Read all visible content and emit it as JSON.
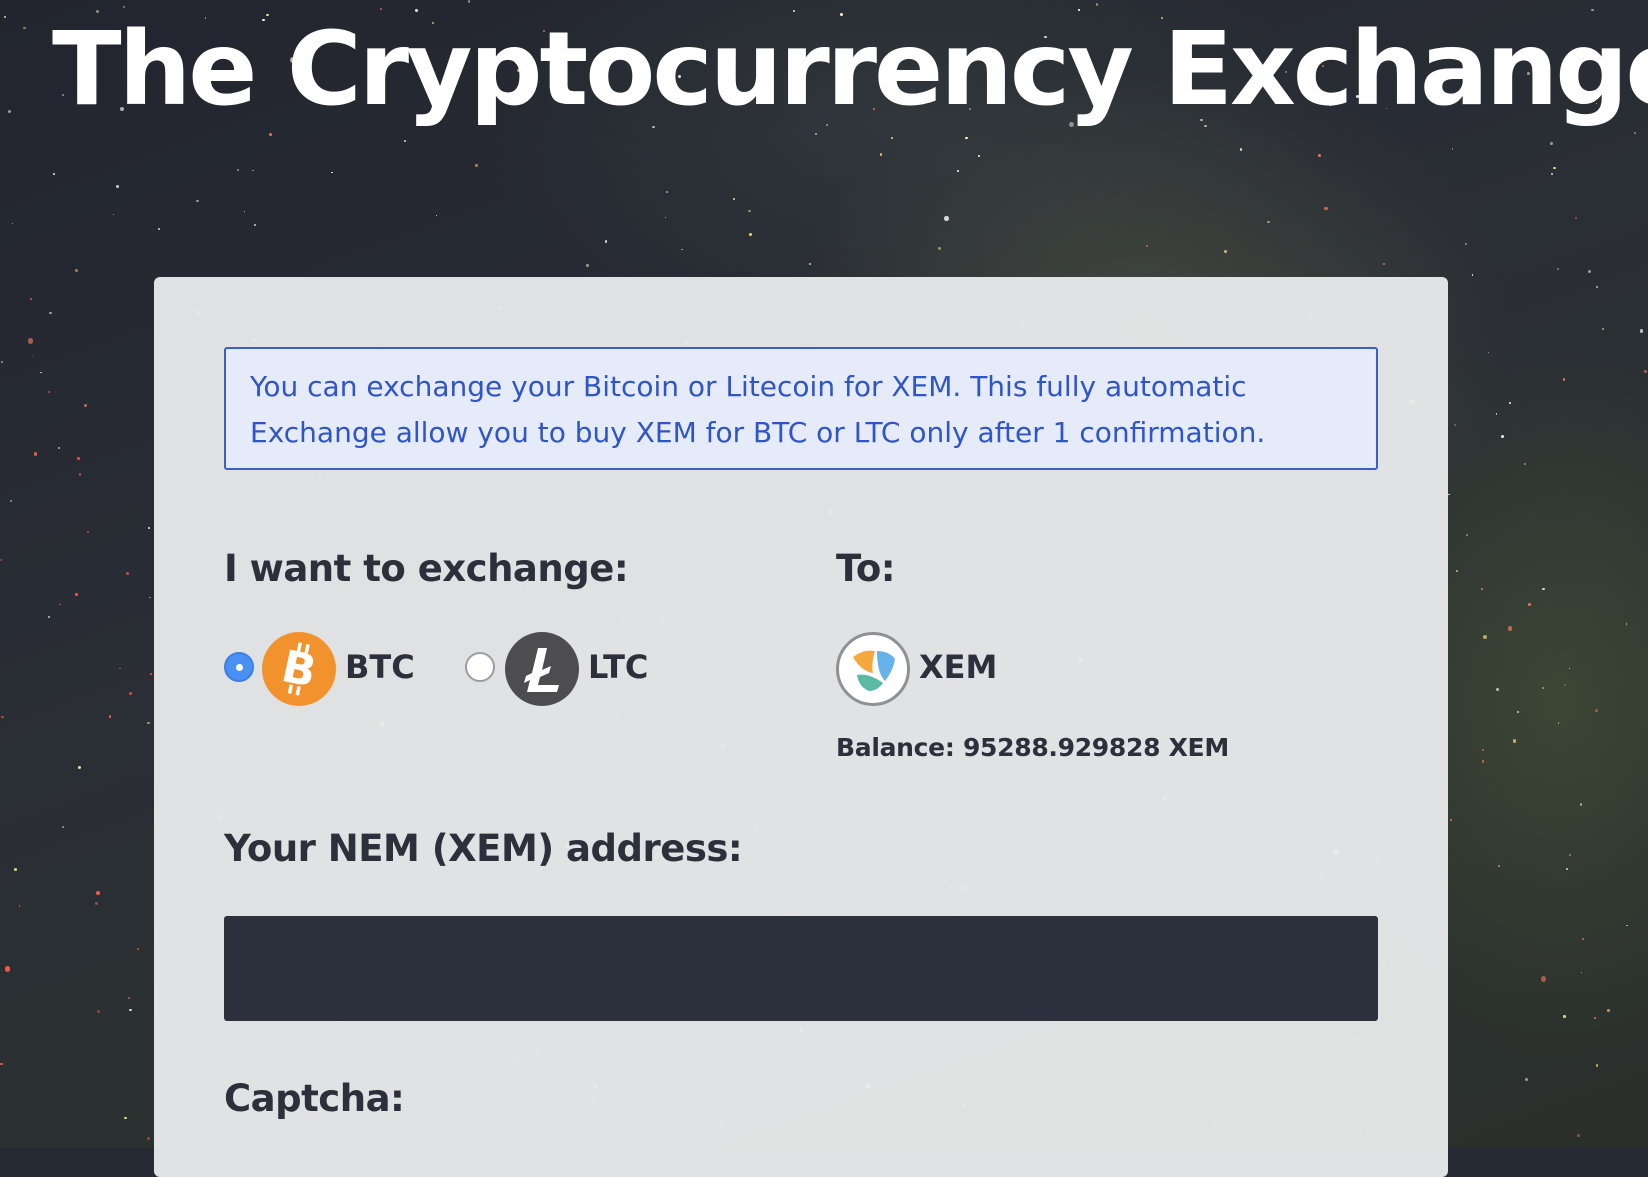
{
  "page": {
    "title": "The Cryptocurrency Exchange"
  },
  "notice": {
    "text": "You can exchange your Bitcoin or Litecoin for XEM. This fully automatic Exchange allow you to buy XEM for BTC or LTC only after 1 confirmation."
  },
  "exchange_from": {
    "label": "I want to exchange:",
    "options": [
      {
        "code": "BTC",
        "icon": "bitcoin-icon",
        "color": "#f2922d",
        "selected": true
      },
      {
        "code": "LTC",
        "icon": "litecoin-icon",
        "color": "#4d4d4f",
        "selected": false
      }
    ]
  },
  "exchange_to": {
    "label": "To:",
    "currency": {
      "code": "XEM",
      "icon": "nem-icon"
    },
    "balance": "Balance: 95288.929828 XEM"
  },
  "address": {
    "label": "Your NEM (XEM) address:",
    "value": "",
    "placeholder": ""
  },
  "captcha": {
    "label": "Captcha:"
  },
  "colors": {
    "notice_text": "#2f55c6",
    "notice_border": "#3a5fc5",
    "radio_selected": "#4a8ff2",
    "input_bg": "#2d313d"
  }
}
